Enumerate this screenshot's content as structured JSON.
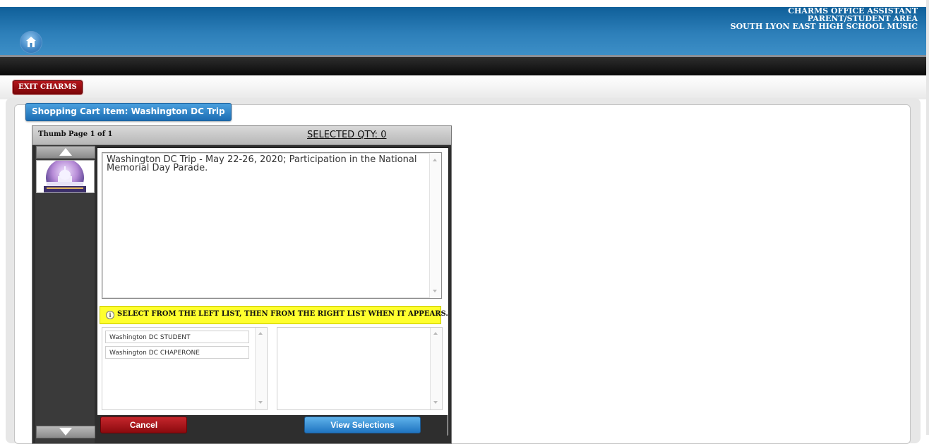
{
  "header": {
    "title_lines": [
      "CHARMS OFFICE ASSISTANT",
      "PARENT/STUDENT AREA",
      "SOUTH LYON EAST HIGH SCHOOL MUSIC"
    ],
    "home_icon": "home-icon"
  },
  "toolbar": {
    "exit_label": "EXIT CHARMS"
  },
  "panel": {
    "title": "Shopping Cart Item: Washington DC Trip"
  },
  "cart": {
    "thumb_page": "Thumb Page 1 of 1",
    "selected_qty": "SELECTED QTY: 0",
    "description": "Washington DC Trip - May 22-26, 2020; Participation in the National Memorial Day Parade.",
    "notice_icon": "info-icon",
    "notice": "SELECT FROM THE LEFT LIST, THEN FROM THE RIGHT LIST WHEN IT APPEARS.",
    "left_list": [
      "Washington DC STUDENT",
      "Washington DC CHAPERONE"
    ],
    "right_list": [],
    "cancel_label": "Cancel",
    "view_label": "View Selections"
  },
  "colors": {
    "header_blue": "#2d7fb9",
    "exit_red": "#9a0a0f",
    "notice_yellow": "#ffff2e",
    "view_blue": "#1f74c1"
  }
}
